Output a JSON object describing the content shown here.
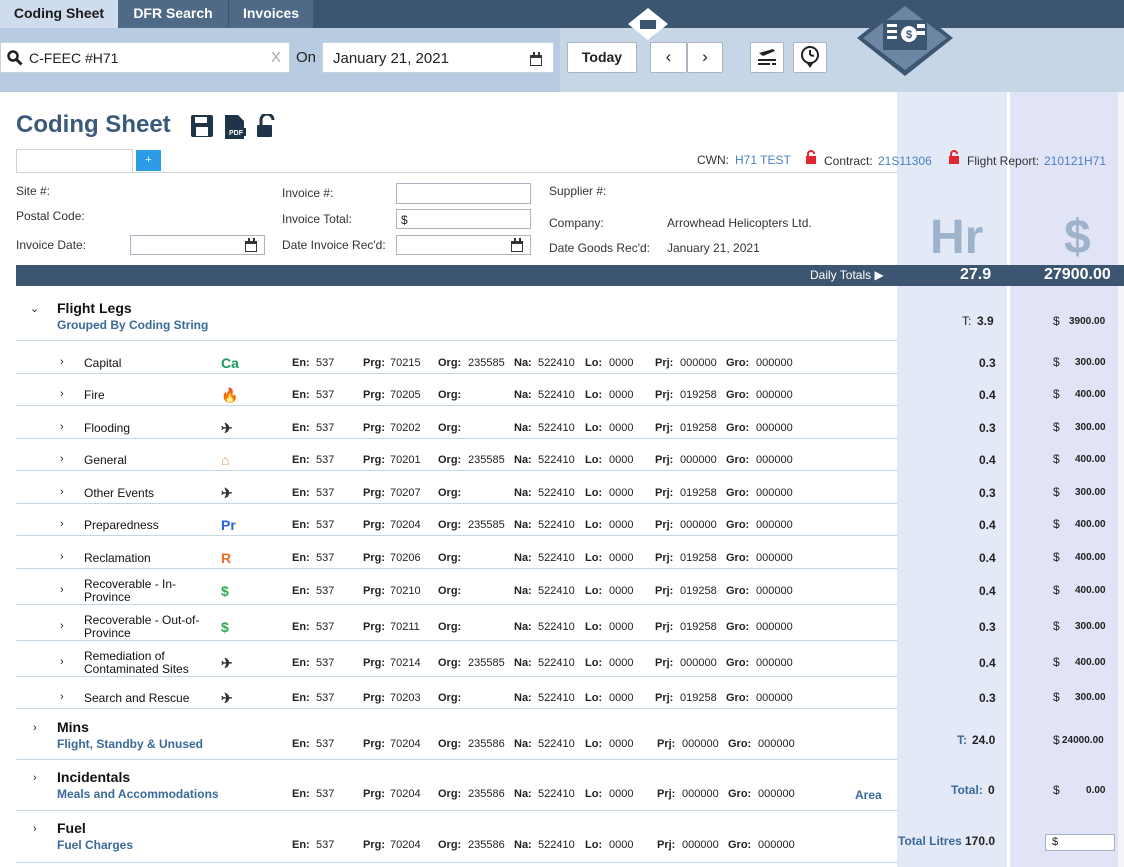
{
  "tabs": [
    "Coding Sheet",
    "DFR Search",
    "Invoices"
  ],
  "search": {
    "value": "C-FEEC #H71",
    "clear": "X"
  },
  "on_label": "On",
  "date": {
    "value": "January 21, 2021"
  },
  "today_label": "Today",
  "prev_label": "‹",
  "next_label": "›",
  "icons": {
    "save": "save-icon",
    "pdf": "pdf-icon",
    "lock": "unlock-icon",
    "flight": "flight-log-icon",
    "clock": "clock-pin-icon",
    "calendar": "calendar-icon"
  },
  "colors": {
    "nav": "#3c5571",
    "header": "#b7cbe1",
    "accent": "#2d9be8",
    "link": "#4a7fc1",
    "hrcol": "#e3e9f7"
  },
  "title": "Coding Sheet",
  "plus": "+",
  "cwn": {
    "label": "CWN:",
    "value": "H71 TEST"
  },
  "contract": {
    "label": "Contract:",
    "value": "21S11306"
  },
  "flight_report": {
    "label": "Flight Report:",
    "value": "210121H71"
  },
  "form": {
    "site": "Site #:",
    "postal": "Postal Code:",
    "invdate": "Invoice Date:",
    "invno": "Invoice #:",
    "invtotal": "Invoice Total:",
    "invtotal_val": "$",
    "daterec": "Date Invoice Rec'd:",
    "supplier": "Supplier #:",
    "company": "Company:",
    "company_val": "Arrowhead Helicopters Ltd.",
    "goods": "Date Goods Rec'd:",
    "goods_val": "January 21, 2021"
  },
  "col_hr": "Hr",
  "col_dollar": "$",
  "daily": {
    "label": "Daily Totals ▶",
    "hours": "27.9",
    "amount": "27900.00"
  },
  "code_labels": {
    "en": "En:",
    "prg": "Prg:",
    "org": "Org:",
    "na": "Na:",
    "lo": "Lo:",
    "prj": "Prj:",
    "gro": "Gro:"
  },
  "flight_legs": {
    "title": "Flight Legs",
    "subtitle": "Grouped By Coding String",
    "total_label": "T:",
    "total": "3.9",
    "dollar": "$",
    "amount": "3900.00",
    "chevron": "⌄"
  },
  "rows": [
    {
      "name": "Capital",
      "icon": "Ca",
      "icon_name": "capital-icon",
      "color": "#1a9a5a",
      "en": "537",
      "prg": "70215",
      "org": "235585",
      "na": "522410",
      "lo": "0000",
      "prj": "000000",
      "gro": "000000",
      "hours": "0.3",
      "amount": "300.00"
    },
    {
      "name": "Fire",
      "icon": "🔥",
      "icon_name": "fire-icon",
      "color": "#f5a623",
      "en": "537",
      "prg": "70205",
      "org": "",
      "na": "522410",
      "lo": "0000",
      "prj": "019258",
      "gro": "000000",
      "hours": "0.4",
      "amount": "400.00"
    },
    {
      "name": "Flooding",
      "icon": "✈",
      "icon_name": "aircraft-icon",
      "color": "#333",
      "en": "537",
      "prg": "70202",
      "org": "",
      "na": "522410",
      "lo": "0000",
      "prj": "019258",
      "gro": "000000",
      "hours": "0.3",
      "amount": "300.00"
    },
    {
      "name": "General",
      "icon": "⌂",
      "icon_name": "house-icon",
      "color": "#d9a25b",
      "en": "537",
      "prg": "70201",
      "org": "235585",
      "na": "522410",
      "lo": "0000",
      "prj": "000000",
      "gro": "000000",
      "hours": "0.4",
      "amount": "400.00"
    },
    {
      "name": "Other Events",
      "icon": "✈",
      "icon_name": "aircraft-icon",
      "color": "#333",
      "en": "537",
      "prg": "70207",
      "org": "",
      "na": "522410",
      "lo": "0000",
      "prj": "019258",
      "gro": "000000",
      "hours": "0.3",
      "amount": "300.00"
    },
    {
      "name": "Preparedness",
      "icon": "Pr",
      "icon_name": "preparedness-icon",
      "color": "#2a62d8",
      "en": "537",
      "prg": "70204",
      "org": "235585",
      "na": "522410",
      "lo": "0000",
      "prj": "000000",
      "gro": "000000",
      "hours": "0.4",
      "amount": "400.00"
    },
    {
      "name": "Reclamation",
      "icon": "R",
      "icon_name": "reclamation-icon",
      "color": "#f06a2a",
      "en": "537",
      "prg": "70206",
      "org": "",
      "na": "522410",
      "lo": "0000",
      "prj": "019258",
      "gro": "000000",
      "hours": "0.4",
      "amount": "400.00"
    },
    {
      "name": "Recoverable - In-\nProvince",
      "icon": "$",
      "icon_name": "dollar-icon",
      "color": "#2ba84a",
      "en": "537",
      "prg": "70210",
      "org": "",
      "na": "522410",
      "lo": "0000",
      "prj": "019258",
      "gro": "000000",
      "hours": "0.4",
      "amount": "400.00"
    },
    {
      "name": "Recoverable - Out-of-\nProvince",
      "icon": "$",
      "icon_name": "dollar-icon",
      "color": "#2ba84a",
      "en": "537",
      "prg": "70211",
      "org": "",
      "na": "522410",
      "lo": "0000",
      "prj": "019258",
      "gro": "000000",
      "hours": "0.3",
      "amount": "300.00"
    },
    {
      "name": "Remediation of\nContaminated Sites",
      "icon": "✈",
      "icon_name": "aircraft-icon",
      "color": "#333",
      "en": "537",
      "prg": "70214",
      "org": "235585",
      "na": "522410",
      "lo": "0000",
      "prj": "000000",
      "gro": "000000",
      "hours": "0.4",
      "amount": "400.00"
    },
    {
      "name": "Search and Rescue",
      "icon": "✈",
      "icon_name": "aircraft-icon",
      "color": "#333",
      "en": "537",
      "prg": "70203",
      "org": "",
      "na": "522410",
      "lo": "0000",
      "prj": "019258",
      "gro": "000000",
      "hours": "0.3",
      "amount": "300.00"
    }
  ],
  "groups": [
    {
      "title": "Mins",
      "subtitle": "Flight, Standby & Unused",
      "en": "537",
      "prg": "70204",
      "org": "235586",
      "na": "522410",
      "lo": "0000",
      "prj": "000000",
      "gro": "000000",
      "tlabel": "T:",
      "tval": "24.0",
      "dollar": "$",
      "amount": "24000.00",
      "extra": ""
    },
    {
      "title": "Incidentals",
      "subtitle": "Meals and Accommodations",
      "en": "537",
      "prg": "70204",
      "org": "235586",
      "na": "522410",
      "lo": "0000",
      "prj": "000000",
      "gro": "000000",
      "tlabel": "Total:",
      "tval": "0",
      "dollar": "$",
      "amount": "0.00",
      "extra": "Area"
    },
    {
      "title": "Fuel",
      "subtitle": "Fuel Charges",
      "en": "537",
      "prg": "70204",
      "org": "235586",
      "na": "522410",
      "lo": "0000",
      "prj": "000000",
      "gro": "000000",
      "tlabel": "Total Litres",
      "tval": "170.0",
      "dollar": "$",
      "amount": "",
      "extra": ""
    }
  ]
}
